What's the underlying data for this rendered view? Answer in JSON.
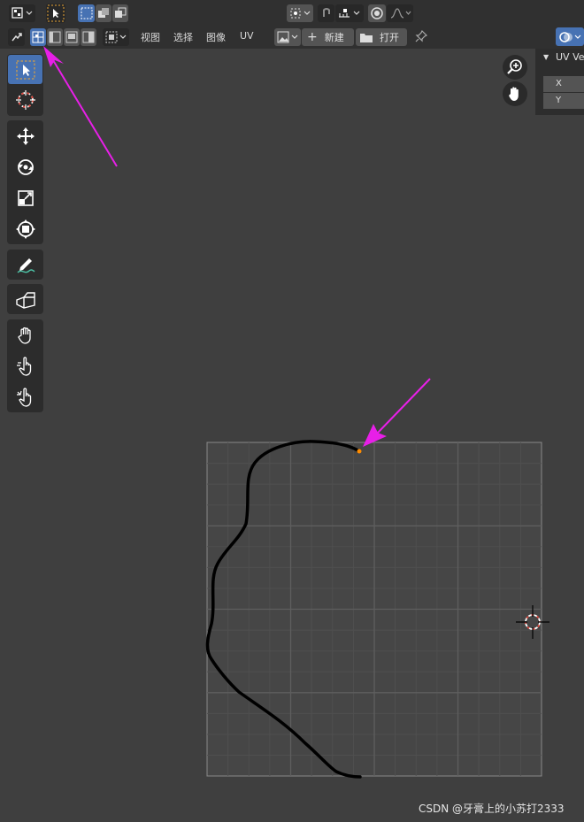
{
  "header": {
    "menu": [
      "视图",
      "选择",
      "图像",
      "UV"
    ],
    "new_label": "新建",
    "open_label": "打开"
  },
  "sidebar_panel": {
    "title": "UV Ve",
    "fields": [
      "X",
      "Y"
    ]
  },
  "toolbar": {
    "tools": [
      {
        "name": "select-box-tool",
        "icon": "select-box-icon",
        "active": true
      },
      {
        "name": "cursor-tool",
        "icon": "cursor-icon",
        "active": false
      },
      {
        "name": "move-tool",
        "icon": "move-icon",
        "active": false
      },
      {
        "name": "rotate-tool",
        "icon": "rotate-icon",
        "active": false
      },
      {
        "name": "scale-tool",
        "icon": "scale-icon",
        "active": false
      },
      {
        "name": "transform-tool",
        "icon": "transform-icon",
        "active": false
      },
      {
        "name": "annotate-tool",
        "icon": "annotate-pen-icon",
        "active": false
      },
      {
        "name": "rip-region-tool",
        "icon": "rip-region-icon",
        "active": false
      },
      {
        "name": "grab-tool",
        "icon": "grab-hand-icon",
        "active": false
      },
      {
        "name": "relax-tool",
        "icon": "relax-hand-icon",
        "active": false
      },
      {
        "name": "pinch-tool",
        "icon": "pinch-hand-icon",
        "active": false
      }
    ]
  },
  "colors": {
    "accent": "#4772b3",
    "arrow": "#e81fe8",
    "stroke": "#000000",
    "selected_vertex": "#ff8c00"
  },
  "watermark": "CSDN @牙膏上的小苏打2333"
}
